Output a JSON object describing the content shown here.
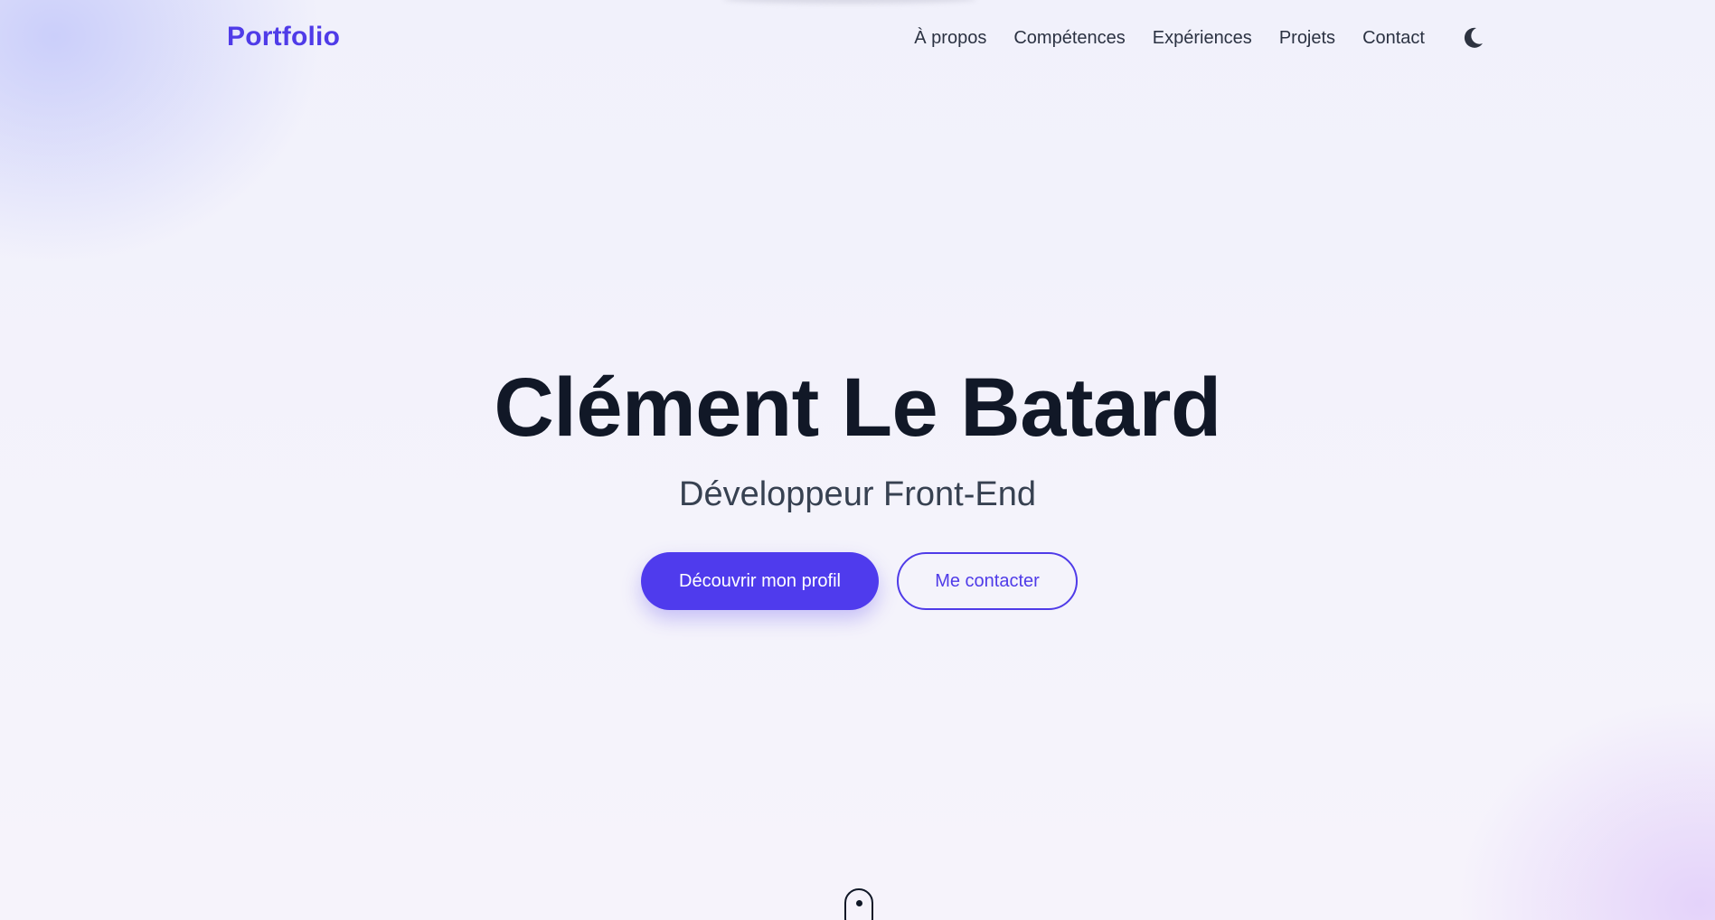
{
  "navbar": {
    "logo": "Portfolio",
    "links": [
      {
        "label": "À propos"
      },
      {
        "label": "Compétences"
      },
      {
        "label": "Expériences"
      },
      {
        "label": "Projets"
      },
      {
        "label": "Contact"
      }
    ],
    "theme_toggle_icon": "moon-icon"
  },
  "hero": {
    "title": "Clément Le Batard",
    "subtitle": "Développeur Front-End",
    "primary_button": "Découvrir mon profil",
    "secondary_button": "Me contacter",
    "scroll_icon": "mouse-scroll-icon"
  },
  "colors": {
    "accent": "#4f3bed",
    "text_dark": "#111827",
    "text_muted": "#374151",
    "background": "#f1f1fb"
  }
}
